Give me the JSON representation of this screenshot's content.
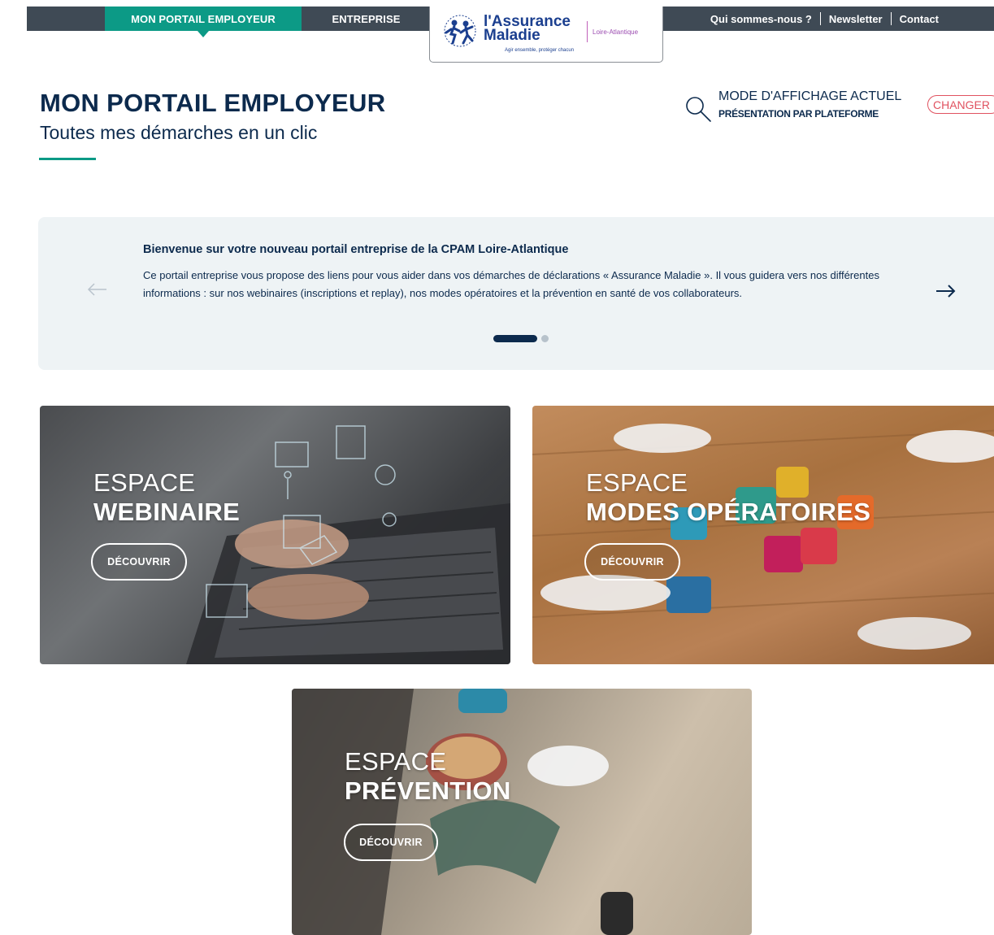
{
  "topbar": {
    "tabs": [
      {
        "label": "MON PORTAIL EMPLOYEUR",
        "active": true
      },
      {
        "label": "ENTREPRISE",
        "active": false
      }
    ],
    "links": [
      {
        "label": "Qui sommes-nous ?"
      },
      {
        "label": "Newsletter"
      },
      {
        "label": "Contact"
      }
    ]
  },
  "logo": {
    "name_line1": "l'Assurance",
    "name_line2": "Maladie",
    "tagline": "Agir ensemble, protéger chacun",
    "region": "Loire-Atlantique"
  },
  "header": {
    "title_light": "MON PORTAIL ",
    "title_bold": "EMPLOYEUR",
    "subtitle": "Toutes mes démarches en un clic"
  },
  "display_mode": {
    "label": "MODE D'AFFICHAGE ACTUEL",
    "value": "PRÉSENTATION PAR PLATEFORME",
    "change_label": "CHANGER"
  },
  "carousel": {
    "title": "Bienvenue sur votre nouveau portail entreprise de la CPAM Loire-Atlantique",
    "text": "Ce portail entreprise vous propose des liens pour vous aider dans vos démarches de déclarations « Assurance Maladie ». Il vous guidera vers nos différentes informations : sur nos webinaires (inscriptions et replay), nos modes opératoires et la prévention en santé de vos collaborateurs.",
    "slide_count": 2,
    "active_slide": 1
  },
  "cards": [
    {
      "line1": "ESPACE",
      "line2": "WEBINAIRE",
      "button": "DÉCOUVRIR"
    },
    {
      "line1": "ESPACE",
      "line2": "MODES OPÉRATOIRES",
      "button": "DÉCOUVRIR"
    },
    {
      "line1": "ESPACE",
      "line2": "PRÉVENTION",
      "button": "DÉCOUVRIR"
    }
  ],
  "colors": {
    "topbar": "#3f4a55",
    "accent_teal": "#0c9a86",
    "navy": "#0c2a4d",
    "change_red": "#e05260",
    "carousel_bg": "#eef3f5"
  },
  "icons": {
    "search": "search-icon",
    "prev": "arrow-left-icon",
    "next": "arrow-right-icon"
  }
}
